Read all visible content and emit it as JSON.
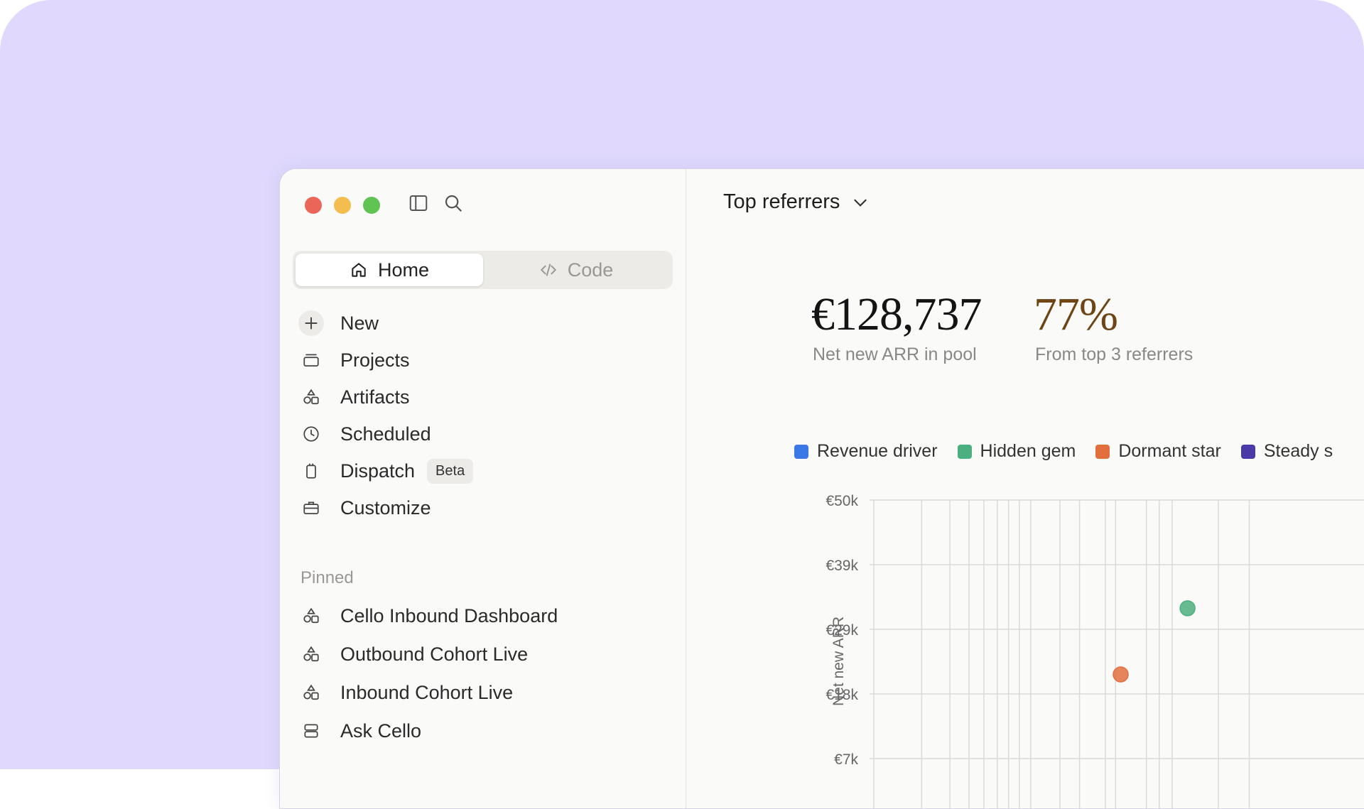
{
  "sidebar": {
    "tabs": [
      {
        "label": "Home",
        "icon": "home-icon",
        "active": true
      },
      {
        "label": "Code",
        "icon": "code-icon",
        "active": false
      }
    ],
    "nav": [
      {
        "label": "New",
        "icon": "plus-icon"
      },
      {
        "label": "Projects",
        "icon": "folder-icon"
      },
      {
        "label": "Artifacts",
        "icon": "shapes-icon"
      },
      {
        "label": "Scheduled",
        "icon": "clock-icon"
      },
      {
        "label": "Dispatch",
        "icon": "device-icon",
        "badge": "Beta"
      },
      {
        "label": "Customize",
        "icon": "briefcase-icon"
      }
    ],
    "pinned_label": "Pinned",
    "pinned": [
      {
        "label": "Cello Inbound Dashboard",
        "icon": "shapes-icon"
      },
      {
        "label": "Outbound Cohort Live",
        "icon": "shapes-icon"
      },
      {
        "label": "Inbound Cohort Live",
        "icon": "shapes-icon"
      },
      {
        "label": "Ask Cello",
        "icon": "server-icon"
      }
    ]
  },
  "main": {
    "title": "Top referrers",
    "metrics": [
      {
        "value": "€128,737",
        "label": "Net new ARR in pool"
      },
      {
        "value": "77%",
        "label": "From top 3 referrers"
      }
    ]
  },
  "colors": {
    "revenue_driver": "#3b78e7",
    "hidden_gem": "#4caf7f",
    "dormant_star": "#e2703f",
    "steady": "#4a3aa8",
    "accent_metric": "#6e4615"
  },
  "chart_data": {
    "type": "scatter",
    "ylabel": "Net new ARR",
    "y_ticks": [
      "€50k",
      "€39k",
      "€29k",
      "€18k",
      "€7k"
    ],
    "legend": [
      {
        "name": "Revenue driver",
        "color": "#3b78e7"
      },
      {
        "name": "Hidden gem",
        "color": "#4caf7f"
      },
      {
        "name": "Dormant star",
        "color": "#e2703f"
      },
      {
        "name": "Steady s",
        "color": "#4a3aa8"
      }
    ],
    "series": [
      {
        "name": "Hidden gem",
        "points": [
          {
            "x": 0.61,
            "y": 32000
          }
        ]
      },
      {
        "name": "Dormant star",
        "points": [
          {
            "x": 0.48,
            "y": 21000
          }
        ]
      }
    ]
  }
}
